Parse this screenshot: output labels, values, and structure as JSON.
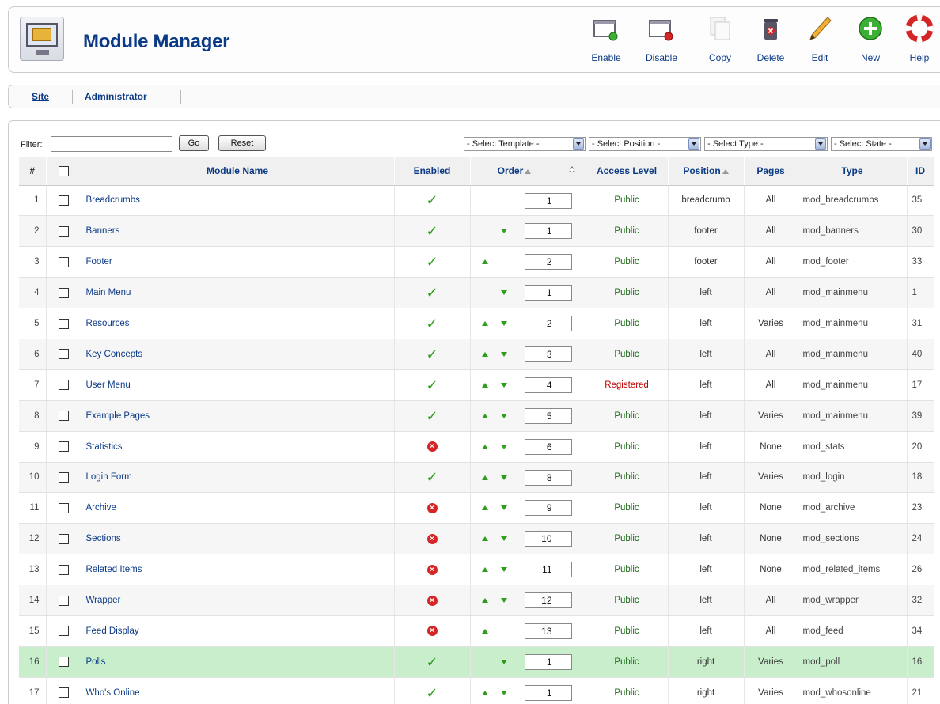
{
  "header": {
    "title": "Module Manager"
  },
  "toolbar": [
    {
      "label": "Enable",
      "icon": "enable-icon"
    },
    {
      "label": "Disable",
      "icon": "disable-icon"
    },
    {
      "label": "Copy",
      "icon": "copy-icon"
    },
    {
      "label": "Delete",
      "icon": "delete-icon"
    },
    {
      "label": "Edit",
      "icon": "edit-icon"
    },
    {
      "label": "New",
      "icon": "new-icon"
    },
    {
      "label": "Help",
      "icon": "help-icon"
    }
  ],
  "submenu": {
    "site": "Site",
    "administrator": "Administrator"
  },
  "filter": {
    "label": "Filter:",
    "value": "",
    "go": "Go",
    "reset": "Reset",
    "select_template": "- Select Template -",
    "select_position": "- Select Position -",
    "select_type": "- Select Type -",
    "select_state": "- Select State -"
  },
  "columns": {
    "num": "#",
    "name": "Module Name",
    "enabled": "Enabled",
    "order": "Order",
    "access": "Access Level",
    "position": "Position",
    "pages": "Pages",
    "type": "Type",
    "id": "ID"
  },
  "rows": [
    {
      "num": "1",
      "name": "Breadcrumbs",
      "enabled": true,
      "up": false,
      "down": false,
      "order": "1",
      "access": "Public",
      "position": "breadcrumb",
      "pages": "All",
      "type": "mod_breadcrumbs",
      "id": "35"
    },
    {
      "num": "2",
      "name": "Banners",
      "enabled": true,
      "up": false,
      "down": true,
      "order": "1",
      "access": "Public",
      "position": "footer",
      "pages": "All",
      "type": "mod_banners",
      "id": "30"
    },
    {
      "num": "3",
      "name": "Footer",
      "enabled": true,
      "up": true,
      "down": false,
      "order": "2",
      "access": "Public",
      "position": "footer",
      "pages": "All",
      "type": "mod_footer",
      "id": "33"
    },
    {
      "num": "4",
      "name": "Main Menu",
      "enabled": true,
      "up": false,
      "down": true,
      "order": "1",
      "access": "Public",
      "position": "left",
      "pages": "All",
      "type": "mod_mainmenu",
      "id": "1"
    },
    {
      "num": "5",
      "name": "Resources",
      "enabled": true,
      "up": true,
      "down": true,
      "order": "2",
      "access": "Public",
      "position": "left",
      "pages": "Varies",
      "type": "mod_mainmenu",
      "id": "31"
    },
    {
      "num": "6",
      "name": "Key Concepts",
      "enabled": true,
      "up": true,
      "down": true,
      "order": "3",
      "access": "Public",
      "position": "left",
      "pages": "All",
      "type": "mod_mainmenu",
      "id": "40"
    },
    {
      "num": "7",
      "name": "User Menu",
      "enabled": true,
      "up": true,
      "down": true,
      "order": "4",
      "access": "Registered",
      "position": "left",
      "pages": "All",
      "type": "mod_mainmenu",
      "id": "17"
    },
    {
      "num": "8",
      "name": "Example Pages",
      "enabled": true,
      "up": true,
      "down": true,
      "order": "5",
      "access": "Public",
      "position": "left",
      "pages": "Varies",
      "type": "mod_mainmenu",
      "id": "39"
    },
    {
      "num": "9",
      "name": "Statistics",
      "enabled": false,
      "up": true,
      "down": true,
      "order": "6",
      "access": "Public",
      "position": "left",
      "pages": "None",
      "type": "mod_stats",
      "id": "20"
    },
    {
      "num": "10",
      "name": "Login Form",
      "enabled": true,
      "up": true,
      "down": true,
      "order": "8",
      "access": "Public",
      "position": "left",
      "pages": "Varies",
      "type": "mod_login",
      "id": "18"
    },
    {
      "num": "11",
      "name": "Archive",
      "enabled": false,
      "up": true,
      "down": true,
      "order": "9",
      "access": "Public",
      "position": "left",
      "pages": "None",
      "type": "mod_archive",
      "id": "23"
    },
    {
      "num": "12",
      "name": "Sections",
      "enabled": false,
      "up": true,
      "down": true,
      "order": "10",
      "access": "Public",
      "position": "left",
      "pages": "None",
      "type": "mod_sections",
      "id": "24"
    },
    {
      "num": "13",
      "name": "Related Items",
      "enabled": false,
      "up": true,
      "down": true,
      "order": "11",
      "access": "Public",
      "position": "left",
      "pages": "None",
      "type": "mod_related_items",
      "id": "26"
    },
    {
      "num": "14",
      "name": "Wrapper",
      "enabled": false,
      "up": true,
      "down": true,
      "order": "12",
      "access": "Public",
      "position": "left",
      "pages": "All",
      "type": "mod_wrapper",
      "id": "32"
    },
    {
      "num": "15",
      "name": "Feed Display",
      "enabled": false,
      "up": true,
      "down": false,
      "order": "13",
      "access": "Public",
      "position": "left",
      "pages": "All",
      "type": "mod_feed",
      "id": "34"
    },
    {
      "num": "16",
      "name": "Polls",
      "enabled": true,
      "up": false,
      "down": true,
      "order": "1",
      "access": "Public",
      "position": "right",
      "pages": "Varies",
      "type": "mod_poll",
      "id": "16",
      "highlight": true
    },
    {
      "num": "17",
      "name": "Who's Online",
      "enabled": true,
      "up": true,
      "down": true,
      "order": "1",
      "access": "Public",
      "position": "right",
      "pages": "Varies",
      "type": "mod_whosonline",
      "id": "21"
    }
  ],
  "colors": {
    "link": "#0b3a86",
    "public": "#1a6a14",
    "registered": "#c00000",
    "enabled": "#2f9e1c",
    "disabled": "#d42626",
    "highlight": "#c8eecb"
  }
}
